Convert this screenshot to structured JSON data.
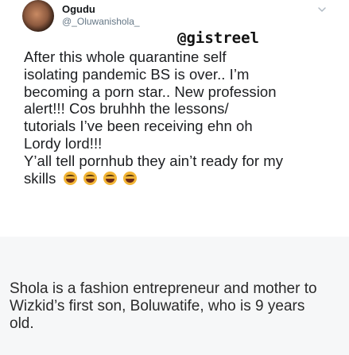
{
  "tweet": {
    "author_name": "Ogudu",
    "author_handle": "@_Oluwanishola_",
    "watermark": "@gistreel",
    "lines": [
      "After this whole quarantine self",
      "isolating pandemic BS is over.. I’m",
      "becoming a porn star.. New profession",
      "alert!!! Cos bruhhh the lessons/",
      "tutorials I’ve been receiving ehn oh",
      "Lordy lord!!!",
      "Y’all tell pornhub they ain’t ready for my",
      "skills"
    ],
    "emojis": [
      "laughing-crying-emoji",
      "laughing-crying-emoji",
      "grinning-emoji",
      "grinning-emoji"
    ],
    "menu_icon": "chevron-down-icon"
  },
  "article": {
    "lines": [
      "Shola is a fashion entrepreneur and mother to",
      "Wizkid’s first son, Boluwatife, who is 9 years",
      "old."
    ]
  }
}
